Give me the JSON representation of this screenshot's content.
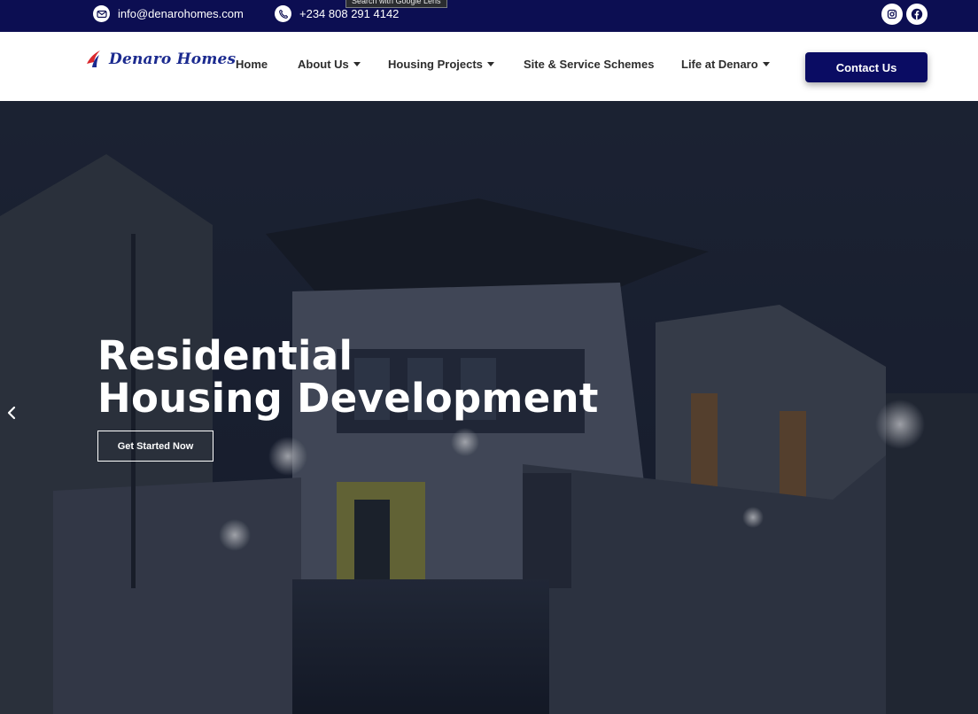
{
  "topbar": {
    "email": "info@denarohomes.com",
    "phone": "+234 808 291 4142",
    "email_icon": "mail-icon",
    "phone_icon": "phone-icon",
    "social": [
      "instagram-icon",
      "facebook-icon"
    ],
    "lens_tooltip": "Search with Google Lens"
  },
  "brand": {
    "logo_text": "Denaro Homes",
    "primary_color": "#0c0e52",
    "accent_color": "#d9262c"
  },
  "nav": {
    "items": [
      {
        "label": "Home",
        "dropdown": false
      },
      {
        "label": "About Us",
        "dropdown": true
      },
      {
        "label": "Housing Projects",
        "dropdown": true
      },
      {
        "label": "Site & Service Schemes",
        "dropdown": false
      },
      {
        "label": "Life at Denaro",
        "dropdown": true
      }
    ],
    "cta": "Contact Us"
  },
  "hero": {
    "title_line1": "Residential",
    "title_line2": "Housing Development",
    "button": "Get Started Now",
    "prev_icon": "chevron-left-icon"
  }
}
